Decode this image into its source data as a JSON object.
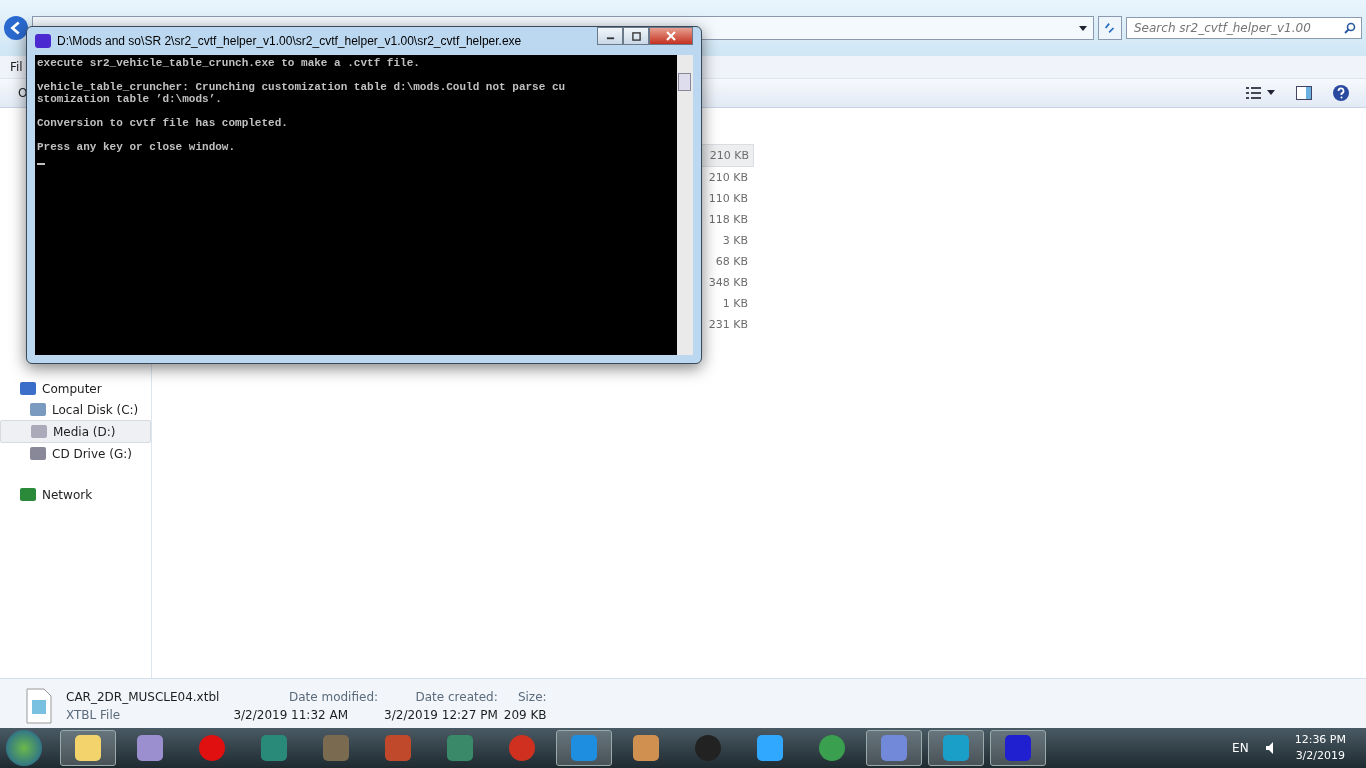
{
  "explorer": {
    "search": {
      "placeholder": "Search sr2_cvtf_helper_v1.00"
    },
    "menu_fragment": "Fil",
    "toolbar_fragment": "O",
    "file_sizes": [
      {
        "size": "210 KB",
        "selected": true
      },
      {
        "size": "210 KB",
        "selected": false
      },
      {
        "size": "110 KB",
        "selected": false
      },
      {
        "size": "118 KB",
        "selected": false
      },
      {
        "size": "3 KB",
        "selected": false
      },
      {
        "size": "68 KB",
        "selected": false
      },
      {
        "size": "348 KB",
        "selected": false
      },
      {
        "size": "1 KB",
        "selected": false
      },
      {
        "size": "231 KB",
        "selected": false
      }
    ],
    "sidebar": [
      {
        "label": "Computer",
        "kind": "computer",
        "selected": false,
        "children": [
          {
            "label": "Local Disk (C:)",
            "kind": "system-disk",
            "selected": false
          },
          {
            "label": "Media (D:)",
            "kind": "disk",
            "selected": true
          },
          {
            "label": "CD Drive (G:)",
            "kind": "cd",
            "selected": false
          }
        ]
      },
      {
        "label": "Network",
        "kind": "network",
        "selected": false
      }
    ],
    "details": {
      "name": "CAR_2DR_MUSCLE04.xtbl",
      "type": "XTBL File",
      "fields": [
        {
          "label": "Date modified:",
          "value": "3/2/2019 11:32 AM"
        },
        {
          "label": "Date created:",
          "value": "3/2/2019 12:27 PM"
        },
        {
          "label": "Size:",
          "value": "209 KB"
        }
      ]
    }
  },
  "console": {
    "title": "D:\\Mods and so\\SR 2\\sr2_cvtf_helper_v1.00\\sr2_cvtf_helper_v1.00\\sr2_cvtf_helper.exe",
    "paragraphs": [
      [
        "execute sr2_vehicle_table_crunch.exe to make a .cvtf file."
      ],
      [
        "vehicle_table_cruncher: Crunching customization table d:\\mods.Could not parse cu",
        "stomization table ’d:\\mods’."
      ],
      [
        "Conversion to cvtf file has completed."
      ],
      [
        "Press any key or close window."
      ]
    ]
  },
  "taskbar": {
    "items": [
      {
        "kind": "folder",
        "running": true
      },
      {
        "kind": "monitor",
        "running": false
      },
      {
        "kind": "record",
        "running": false
      },
      {
        "kind": "plane",
        "running": false
      },
      {
        "kind": "gimp",
        "running": false
      },
      {
        "kind": "case",
        "running": false
      },
      {
        "kind": "window",
        "running": false
      },
      {
        "kind": "psiphon",
        "running": false
      },
      {
        "kind": "ie",
        "running": true
      },
      {
        "kind": "palette",
        "running": false
      },
      {
        "kind": "creation",
        "running": false
      },
      {
        "kind": "ps",
        "running": false
      },
      {
        "kind": "chrome",
        "running": false
      },
      {
        "kind": "discord",
        "running": true
      },
      {
        "kind": "arrow",
        "running": true
      },
      {
        "kind": "car",
        "running": true
      }
    ],
    "language": "EN",
    "time": "12:36 PM",
    "date": "3/2/2019"
  }
}
